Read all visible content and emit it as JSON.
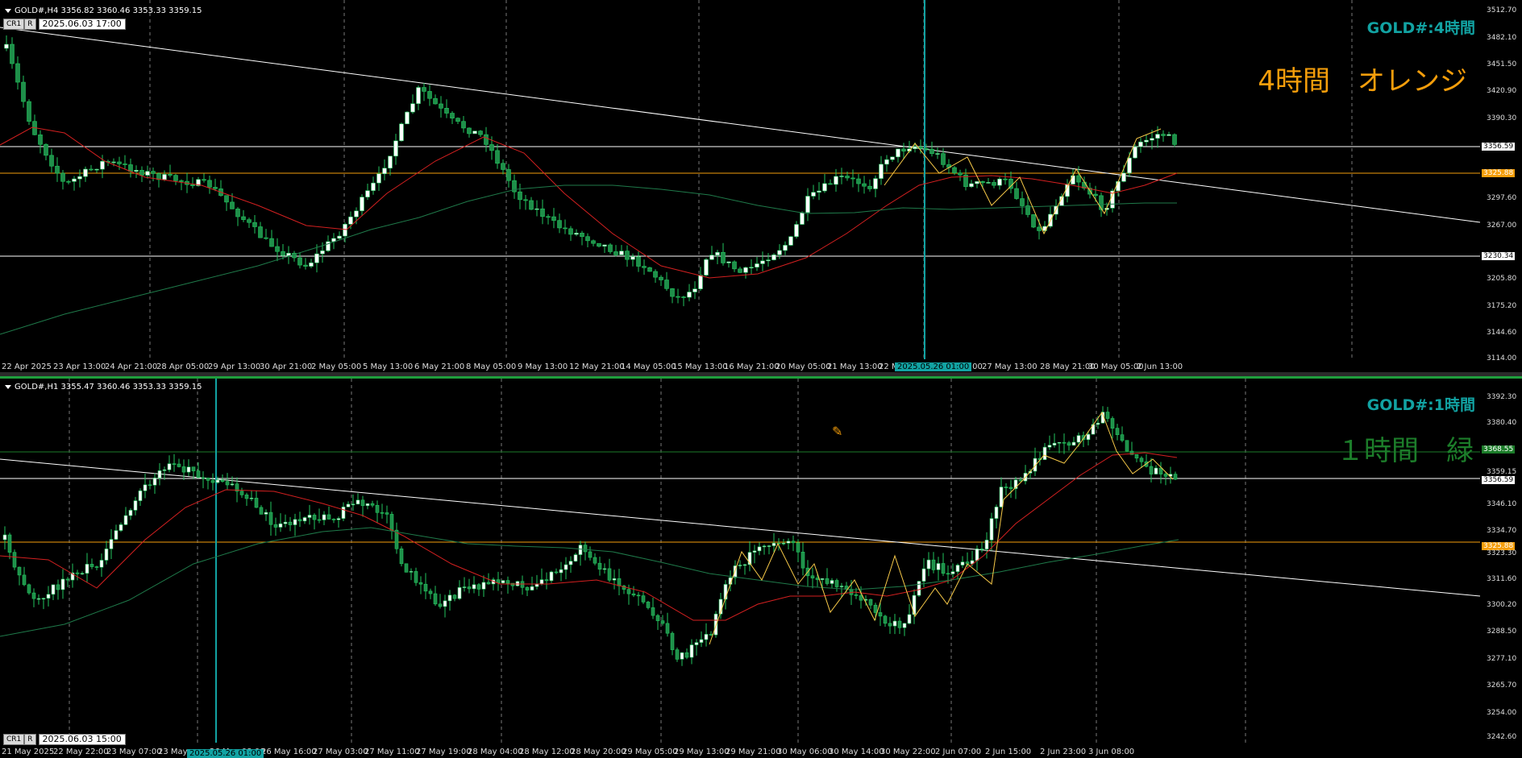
{
  "colors": {
    "background": "#000000",
    "candle": "#22c55e",
    "bull_body": "#ffffff",
    "bear_body": "#1f8f4a",
    "ma_fast": "#d42020",
    "ma_slow": "#1f7a4a",
    "trend": "#ffffff",
    "orange": "#f59e0b",
    "green_level": "#1c7d2a",
    "cyan": "#12a3a3",
    "zigzag": "#f7c948"
  },
  "h4": {
    "header": "GOLD#,H4  3356.82 3360.46 3353.33 3359.15",
    "buttons": [
      "CR1",
      "R"
    ],
    "datetime": "2025.06.03 17:00",
    "symbol_label": "GOLD#:4時間",
    "big_label": "4時間　オレンジ",
    "price_ticks": [
      "3512.70",
      "3482.10",
      "3451.50",
      "3420.90",
      "3390.30",
      "3356.59",
      "3325.88",
      "3297.60",
      "3267.00",
      "3230.34",
      "3205.80",
      "3175.20",
      "3144.60",
      "3114.00"
    ],
    "price_lines": [
      {
        "price": "3356.59",
        "color": "#ffffff"
      },
      {
        "price": "3325.88",
        "color": "#f59e0b"
      },
      {
        "price": "3230.34",
        "color": "#ffffff"
      }
    ],
    "time_labels": [
      "22 Apr 2025",
      "23 Apr 13:00",
      "24 Apr 21:00",
      "28 Apr 05:00",
      "29 Apr 13:00",
      "30 Apr 21:00",
      "2 May 05:00",
      "5 May 13:00",
      "6 May 21:00",
      "8 May 05:00",
      "9 May 13:00",
      "12 May 21:00",
      "14 May 05:00",
      "15 May 13:00",
      "16 May 21:00",
      "20 May 05:00",
      "21 May 13:00",
      "22 M",
      "05:00",
      "27 May 13:00",
      "28 May 21:00",
      "30 May 05:00",
      "2 Jun 13:00"
    ],
    "vline_label": "2025.05.26 01:00"
  },
  "h1": {
    "header": "GOLD#,H1  3355.47 3360.46 3353.33 3359.15",
    "buttons": [
      "CR1",
      "R"
    ],
    "datetime": "2025.06.03 15:00",
    "symbol_label": "GOLD#:1時間",
    "big_label": "１時間　緑",
    "price_ticks": [
      "3392.30",
      "3380.40",
      "3368.55",
      "3359.15",
      "3356.59",
      "3346.10",
      "3334.70",
      "3325.88",
      "3323.30",
      "3311.60",
      "3300.20",
      "3288.50",
      "3277.10",
      "3265.70",
      "3254.00",
      "3242.60"
    ],
    "price_lines": [
      {
        "price": "3368.55",
        "color": "#1c7d2a"
      },
      {
        "price": "3356.59",
        "color": "#ffffff"
      },
      {
        "price": "3325.88",
        "color": "#f59e0b"
      }
    ],
    "time_labels": [
      "21 May 2025",
      "22 May 22:00",
      "23 May 07:00",
      "23 May",
      "26 May 08:00",
      "26 May 16:00",
      "27 May 03:00",
      "27 May 11:00",
      "27 May 19:00",
      "28 May 04:00",
      "28 May 12:00",
      "28 May 20:00",
      "29 May 05:00",
      "29 May 13:00",
      "29 May 21:00",
      "30 May 06:00",
      "30 May 14:00",
      "30 May 22:00",
      "2 Jun 07:00",
      "2 Jun 15:00",
      "2 Jun 23:00",
      "3 Jun 08:00"
    ],
    "vline_label": "2025.05.26 01:00"
  }
}
